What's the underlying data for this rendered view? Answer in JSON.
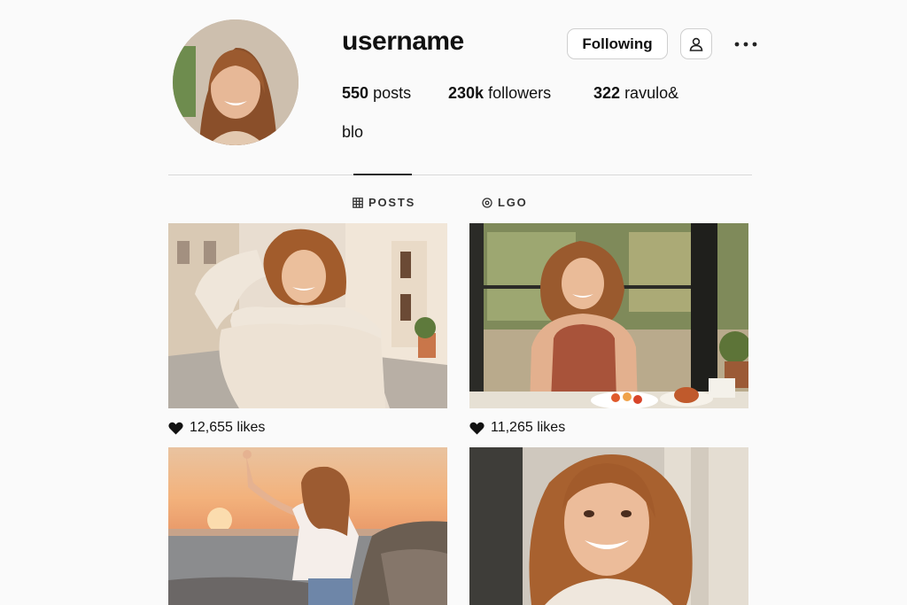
{
  "profile": {
    "username": "username",
    "follow_label": "Following",
    "stats": [
      {
        "count": "550",
        "label": "posts"
      },
      {
        "count": "230k",
        "label": "followers"
      },
      {
        "count": "322",
        "label": "ravulo&"
      }
    ],
    "bio": "blo"
  },
  "tabs": [
    {
      "label": "POSTS",
      "icon": "grid-icon",
      "active": true
    },
    {
      "label": "LGO",
      "icon": "target-icon",
      "active": false
    }
  ],
  "posts": [
    {
      "scene": "street-sweater",
      "likes": "12,655 likes"
    },
    {
      "scene": "cafe-table",
      "likes": "11,265 likes"
    },
    {
      "scene": "sunset-sea",
      "likes": ""
    },
    {
      "scene": "portrait-closeup",
      "likes": ""
    }
  ]
}
